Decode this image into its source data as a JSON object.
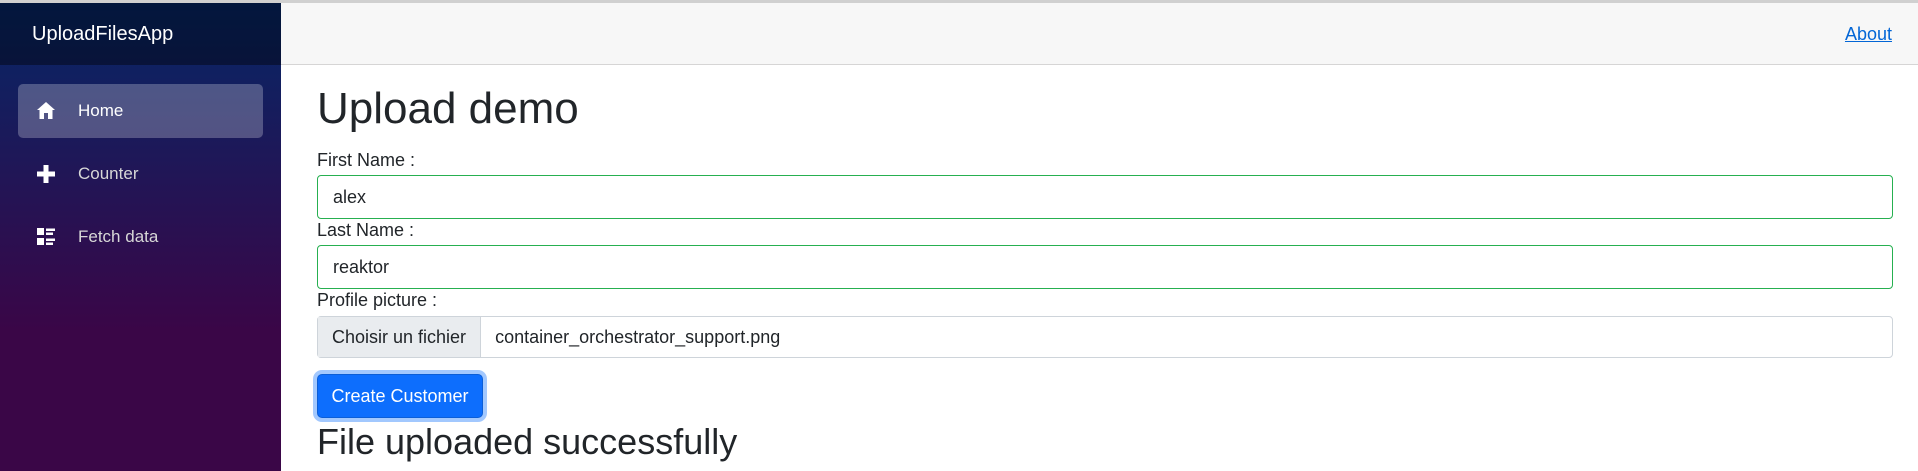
{
  "app": {
    "brand": "UploadFilesApp"
  },
  "sidebar": {
    "items": [
      {
        "label": "Home",
        "icon": "home-icon",
        "active": true
      },
      {
        "label": "Counter",
        "icon": "plus-icon",
        "active": false
      },
      {
        "label": "Fetch data",
        "icon": "list-rich-icon",
        "active": false
      }
    ]
  },
  "topbar": {
    "about_label": "About"
  },
  "main": {
    "title": "Upload demo",
    "form": {
      "first_name_label": "First Name :",
      "first_name_value": "alex",
      "last_name_label": "Last Name :",
      "last_name_value": "reaktor",
      "profile_picture_label": "Profile picture :",
      "file_button_label": "Choisir un fichier",
      "file_name": "container_orchestrator_support.png",
      "submit_label": "Create Customer"
    },
    "result_message": "File uploaded successfully"
  },
  "colors": {
    "sidebar_gradient_top": "#052767",
    "sidebar_gradient_bottom": "#3a0647",
    "primary_button": "#0d6efd",
    "valid_border": "#26b050",
    "link": "#0366d6"
  }
}
